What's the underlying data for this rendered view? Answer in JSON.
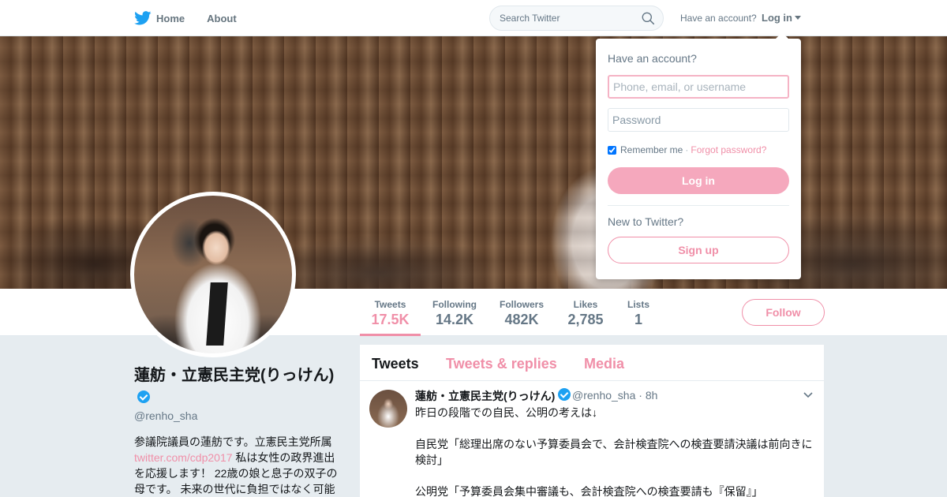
{
  "nav": {
    "home_label": "Home",
    "about_label": "About",
    "search_placeholder": "Search Twitter",
    "have_account": "Have an account?",
    "login_label": "Log in"
  },
  "stats": [
    {
      "label": "Tweets",
      "value": "17.5K"
    },
    {
      "label": "Following",
      "value": "14.2K"
    },
    {
      "label": "Followers",
      "value": "482K"
    },
    {
      "label": "Likes",
      "value": "2,785"
    },
    {
      "label": "Lists",
      "value": "1"
    }
  ],
  "follow_label": "Follow",
  "profile": {
    "name": "蓮舫・立憲民主党(りっけん)",
    "handle": "@renho_sha",
    "bio_before": "参議院議員の蓮舫です。立憲民主党所属",
    "bio_link": "twitter.com/cdp2017",
    "bio_after": " 私は女性の政界進出を応援します！ 22歳の娘と息子の双子の母です。 未来の世代に負担ではなく可能"
  },
  "timeline": {
    "tabs": [
      "Tweets",
      "Tweets & replies",
      "Media"
    ],
    "tweet": {
      "name": "蓮舫・立憲民主党(りっけん)",
      "handle": "@renho_sha · 8h",
      "text": "昨日の段階での自民、公明の考えは↓\n\n自民党「総理出席のない予算委員会で、会計検査院への検査要請決議は前向きに検討」\n\n公明党「予算委員会集中審議も、会計検査院への検査要請も『保留』」"
    }
  },
  "login_dropdown": {
    "title": "Have an account?",
    "username_placeholder": "Phone, email, or username",
    "password_placeholder": "Password",
    "remember_label": "Remember me",
    "separator": "·",
    "forgot_label": "Forgot password?",
    "login_button": "Log in",
    "new_label": "New to Twitter?",
    "signup_button": "Sign up"
  },
  "colors": {
    "accent": "#f08fa8",
    "verified": "#1da1f2",
    "brand_bird": "#1da1f2"
  }
}
